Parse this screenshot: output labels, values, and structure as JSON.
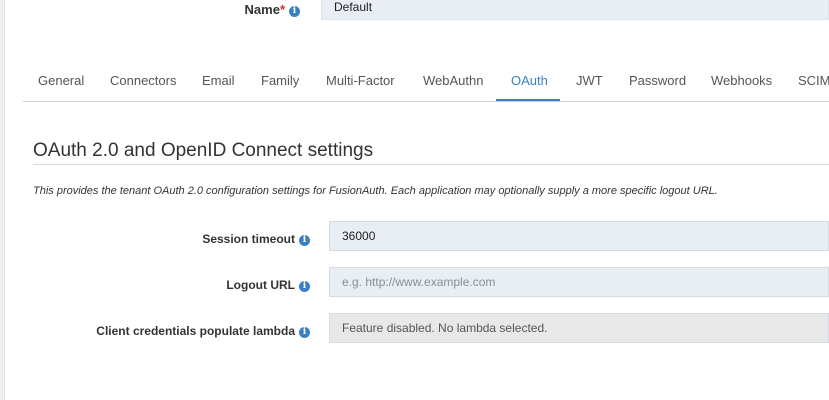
{
  "name_field": {
    "label": "Name",
    "required_mark": "*",
    "value": "Default"
  },
  "tabs": [
    {
      "label": "General"
    },
    {
      "label": "Connectors"
    },
    {
      "label": "Email"
    },
    {
      "label": "Family"
    },
    {
      "label": "Multi-Factor"
    },
    {
      "label": "WebAuthn"
    },
    {
      "label": "OAuth"
    },
    {
      "label": "JWT"
    },
    {
      "label": "Password"
    },
    {
      "label": "Webhooks"
    },
    {
      "label": "SCIM"
    }
  ],
  "active_tab": "OAuth",
  "section": {
    "title": "OAuth 2.0 and OpenID Connect settings",
    "description": "This provides the tenant OAuth 2.0 configuration settings for FusionAuth. Each application may optionally supply a more specific logout URL."
  },
  "fields": {
    "session_timeout": {
      "label": "Session timeout",
      "value": "36000"
    },
    "logout_url": {
      "label": "Logout URL",
      "placeholder": "e.g. http://www.example.com"
    },
    "client_credentials_lambda": {
      "label": "Client credentials populate lambda",
      "value": "Feature disabled. No lambda selected."
    }
  },
  "info_glyph": "i",
  "colors": {
    "accent": "#3b7fc4",
    "input_bg": "#e9edf4",
    "disabled_bg": "#e8e8e8",
    "required": "#c9302c"
  }
}
